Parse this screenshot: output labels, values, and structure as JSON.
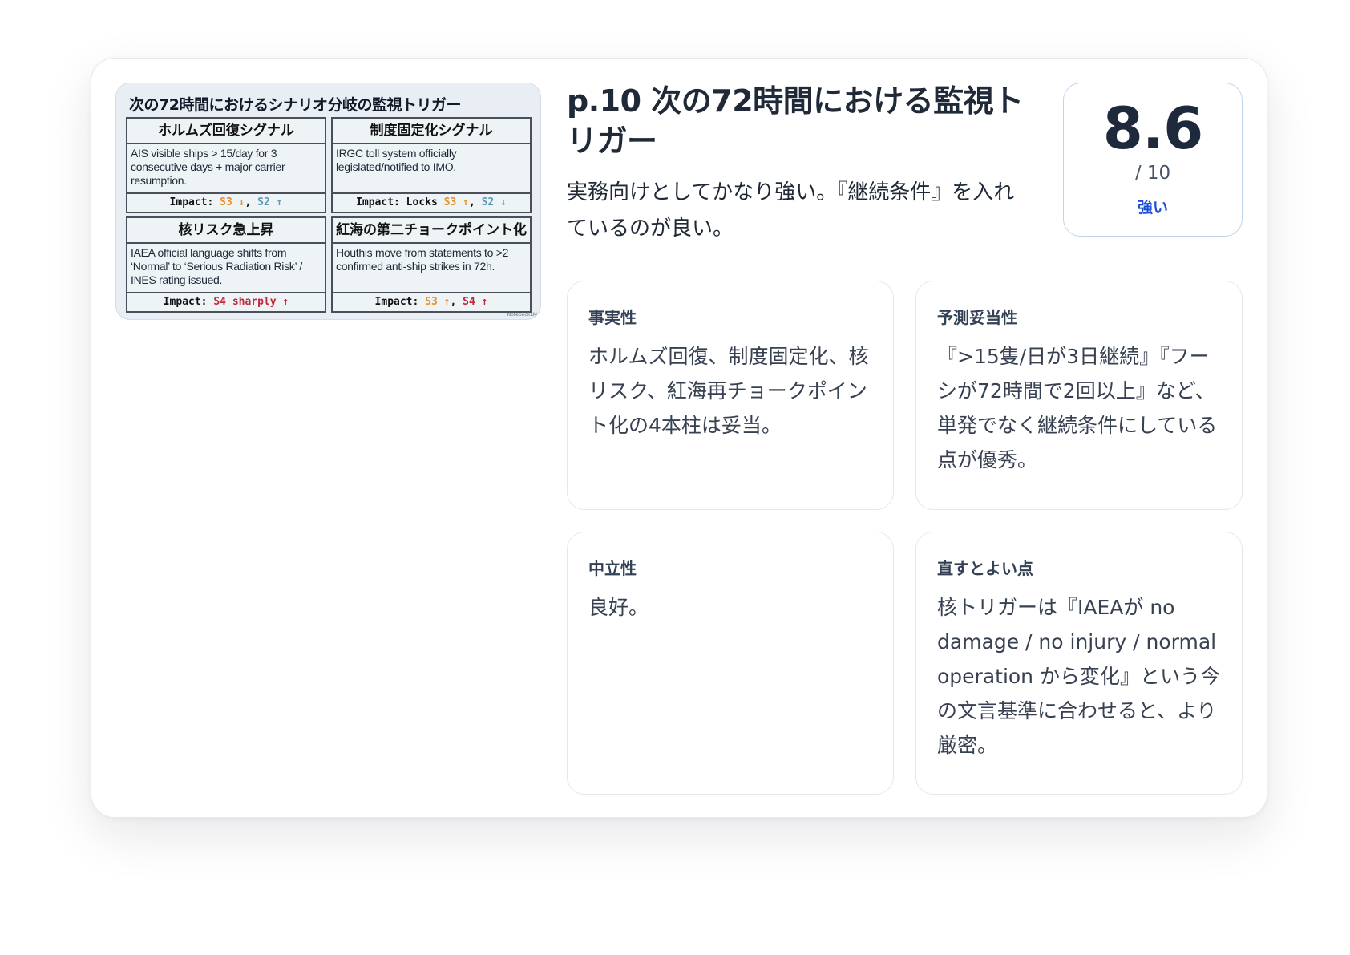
{
  "slide": {
    "title": "次の72時間におけるシナリオ分岐の監視トリガー",
    "signals": [
      {
        "name": "ホルムズ回復シグナル",
        "body": "AIS visible ships > 15/day for 3 consecutive days + major carrier resumption.",
        "impact_prefix": "Impact: ",
        "impact_a": "S3 ↓",
        "impact_sep": ", ",
        "impact_b": "S2 ↑"
      },
      {
        "name": "制度固定化シグナル",
        "body": "IRGC toll system officially legislated/notified to IMO.",
        "impact_prefix": "Impact: Locks ",
        "impact_a": "S3 ↑",
        "impact_sep": ", ",
        "impact_b": "S2 ↓"
      },
      {
        "name": "核リスク急上昇",
        "body": "IAEA official language shifts from ‘Normal’ to ‘Serious Radiation Risk’ / INES rating issued.",
        "impact_prefix": "Impact: ",
        "impact_a": "S4 sharply ↑",
        "impact_sep": "",
        "impact_b": ""
      },
      {
        "name": "紅海の第二チョークポイント化",
        "body": "Houthis move from statements to >2 confirmed anti-ship strikes in 72h.",
        "impact_prefix": "Impact: ",
        "impact_a": "S3 ↑",
        "impact_sep": ", ",
        "impact_b": "S4 ↑"
      }
    ],
    "mark": "NotebookLM"
  },
  "title": "p.10 次の72時間における監視トリガー",
  "summary": "実務向けとしてかなり強い。『継続条件』を入れているのが良い。",
  "score": {
    "value": "8.6",
    "max": "/ 10",
    "label": "強い"
  },
  "criteria": [
    {
      "heading": "事実性",
      "body": "ホルムズ回復、制度固定化、核リスク、紅海再チョークポイント化の4本柱は妥当。"
    },
    {
      "heading": "予測妥当性",
      "body": "『>15隻/日が3日継続』『フーシが72時間で2回以上』など、単発でなく継続条件にしている点が優秀。"
    },
    {
      "heading": "中立性",
      "body": "良好。"
    },
    {
      "heading": "直すとよい点",
      "body": "核トリガーは『IAEAが no damage / no injury / normal operation から変化』という今の文言基準に合わせると、より厳密。"
    }
  ],
  "colors": {
    "accent": "#1d4ed8",
    "down_up_orange": "#e8902a",
    "blue": "#5b9ab8",
    "red": "#c0283a"
  }
}
